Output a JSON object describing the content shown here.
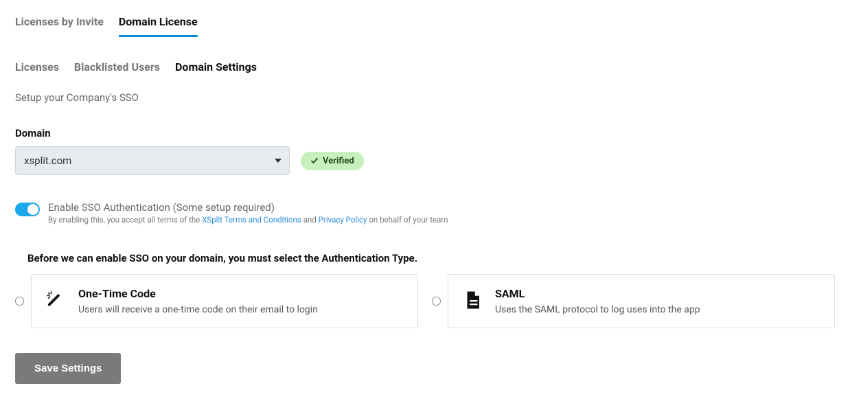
{
  "tabs_top": {
    "invite": "Licenses by Invite",
    "domain": "Domain License"
  },
  "subtabs": {
    "licenses": "Licenses",
    "blacklisted": "Blacklisted Users",
    "settings": "Domain Settings"
  },
  "subtitle": "Setup your Company's SSO",
  "domain_label": "Domain",
  "domain_value": "xsplit.com",
  "verified_label": "Verified",
  "sso_toggle": {
    "title": "Enable SSO Authentication (Some setup required)",
    "terms_prefix": "By enabling this, you accept all terms of the ",
    "terms_link1": "XSplit Terms and Conditions",
    "terms_mid": " and ",
    "terms_link2": "Privacy Policy",
    "terms_suffix": " on behalf of your team"
  },
  "auth_heading": "Before we can enable SSO on your domain, you must select the Authentication Type.",
  "options": {
    "otc": {
      "title": "One-Time Code",
      "desc": "Users will receive a one-time code on their email to login"
    },
    "saml": {
      "title": "SAML",
      "desc": "Uses the SAML protocol to log uses into the app"
    }
  },
  "save_label": "Save Settings"
}
